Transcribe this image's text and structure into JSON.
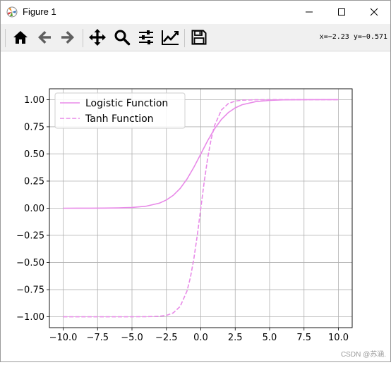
{
  "window": {
    "title": "Figure 1",
    "app_icon": "matplotlib-icon",
    "controls": [
      "minimize-icon",
      "maximize-icon",
      "close-icon"
    ]
  },
  "toolbar": {
    "buttons": [
      {
        "name": "home-button",
        "icon": "home-icon",
        "tooltip": "Reset original view"
      },
      {
        "name": "back-button",
        "icon": "arrow-left-icon",
        "tooltip": "Back"
      },
      {
        "name": "forward-button",
        "icon": "arrow-right-icon",
        "tooltip": "Forward"
      },
      {
        "name": "pan-button",
        "icon": "move-icon",
        "tooltip": "Pan"
      },
      {
        "name": "zoom-button",
        "icon": "magnifier-icon",
        "tooltip": "Zoom"
      },
      {
        "name": "subplots-button",
        "icon": "sliders-icon",
        "tooltip": "Configure subplots"
      },
      {
        "name": "customize-button",
        "icon": "chart-line-icon",
        "tooltip": "Edit axis"
      },
      {
        "name": "save-button",
        "icon": "floppy-disk-icon",
        "tooltip": "Save"
      }
    ],
    "coordinates": "x=−2.23 y=−0.571"
  },
  "watermark": "CSDN @苏涵.",
  "chart_data": {
    "type": "line",
    "title": "",
    "xlabel": "",
    "ylabel": "",
    "xlim": [
      -11,
      11
    ],
    "ylim": [
      -1.1,
      1.1
    ],
    "grid": true,
    "legend_position": "top-left",
    "xticks": [
      -10.0,
      -7.5,
      -5.0,
      -2.5,
      0.0,
      2.5,
      5.0,
      7.5,
      10.0
    ],
    "xtick_labels": [
      "−10.0",
      "−7.5",
      "−5.0",
      "−2.5",
      "0.0",
      "2.5",
      "5.0",
      "7.5",
      "10.0"
    ],
    "yticks": [
      1.0,
      0.75,
      0.5,
      0.25,
      0.0,
      -0.25,
      -0.5,
      -0.75,
      -1.0
    ],
    "ytick_labels": [
      "1.00",
      "0.75",
      "0.50",
      "0.25",
      "0.00",
      "−0.25",
      "−0.50",
      "−0.75",
      "−1.00"
    ],
    "series": [
      {
        "name": "Logistic Function",
        "style": "solid",
        "color": "#e88ae8",
        "x": [
          -10,
          -9,
          -8,
          -7,
          -6,
          -5,
          -4,
          -3,
          -2.5,
          -2,
          -1.5,
          -1,
          -0.5,
          0,
          0.5,
          1,
          1.5,
          2,
          2.5,
          3,
          4,
          5,
          6,
          7,
          8,
          9,
          10
        ],
        "y": [
          0.0,
          0.0001,
          0.0003,
          0.0009,
          0.0025,
          0.0067,
          0.018,
          0.047,
          0.076,
          0.119,
          0.182,
          0.269,
          0.378,
          0.5,
          0.622,
          0.731,
          0.818,
          0.881,
          0.924,
          0.953,
          0.982,
          0.993,
          0.998,
          0.999,
          1.0,
          1.0,
          1.0
        ]
      },
      {
        "name": "Tanh Function",
        "style": "dashed",
        "color": "#e88ae8",
        "x": [
          -10,
          -8,
          -6,
          -4,
          -3,
          -2.5,
          -2,
          -1.5,
          -1,
          -0.75,
          -0.5,
          -0.25,
          0,
          0.25,
          0.5,
          0.75,
          1,
          1.5,
          2,
          2.5,
          3,
          4,
          6,
          8,
          10
        ],
        "y": [
          -1.0,
          -1.0,
          -1.0,
          -0.999,
          -0.995,
          -0.987,
          -0.964,
          -0.905,
          -0.762,
          -0.635,
          -0.462,
          -0.245,
          0.0,
          0.245,
          0.462,
          0.635,
          0.762,
          0.905,
          0.964,
          0.987,
          0.995,
          0.999,
          1.0,
          1.0,
          1.0
        ]
      }
    ]
  }
}
